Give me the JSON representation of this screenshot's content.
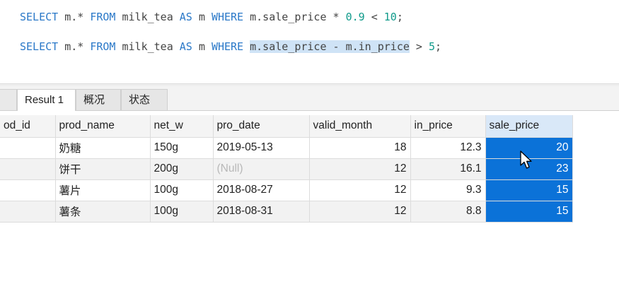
{
  "editor": {
    "line1": {
      "kw_select": "SELECT",
      "t_cols": " m.* ",
      "kw_from": "FROM",
      "t_table": " milk_tea ",
      "kw_as": "AS",
      "t_alias": " m ",
      "kw_where": "WHERE",
      "t_expr": " m.sale_price * ",
      "n_factor": "0.9",
      "t_op": " < ",
      "n_limit": "10",
      "t_end": ";"
    },
    "line2": {
      "kw_select": "SELECT",
      "t_cols": " m.* ",
      "kw_from": "FROM",
      "t_table": " milk_tea ",
      "kw_as": "AS",
      "t_alias": " m ",
      "kw_where": "WHERE",
      "t_space": " ",
      "selected_expr": "m.sale_price - m.in_price",
      "t_op": " > ",
      "n_limit": "5",
      "t_end": ";"
    }
  },
  "tabs": [
    "",
    "Result 1",
    "概况",
    "状态"
  ],
  "grid": {
    "columns": [
      "od_id",
      "prod_name",
      "net_w",
      "pro_date",
      "valid_month",
      "in_price",
      "sale_price"
    ],
    "rows": [
      [
        "",
        "奶糖",
        "150g",
        "2019-05-13",
        "18",
        "12.3",
        "20"
      ],
      [
        "",
        "饼干",
        "200g",
        "(Null)",
        "12",
        "16.1",
        "23"
      ],
      [
        "",
        "薯片",
        "100g",
        "2018-08-27",
        "12",
        "9.3",
        "15"
      ],
      [
        "",
        "薯条",
        "100g",
        "2018-08-31",
        "12",
        "8.8",
        "15"
      ]
    ]
  },
  "colors": {
    "keyword": "#2a78c8",
    "number": "#0f9a8a",
    "selection": "#0b72d8",
    "text_highlight": "#cfe3f6"
  },
  "icons": {
    "cursor": "mouse-pointer-icon"
  }
}
